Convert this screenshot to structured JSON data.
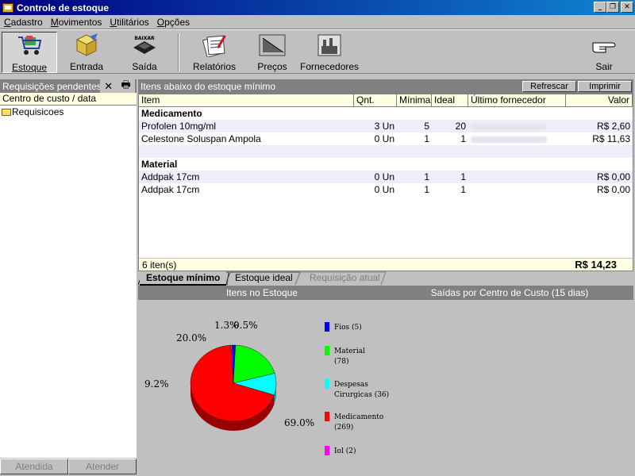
{
  "window": {
    "title": "Controle de estoque"
  },
  "menu": [
    {
      "pre": "",
      "u": "C",
      "post": "adastro"
    },
    {
      "pre": "",
      "u": "M",
      "post": "ovimentos"
    },
    {
      "pre": "",
      "u": "U",
      "post": "tilitários"
    },
    {
      "pre": "",
      "u": "O",
      "post": "pções"
    }
  ],
  "toolbar": {
    "estoque": "Estoque",
    "entrada": "Entrada",
    "saida": "Saída",
    "relatorios": "Relatórios",
    "precos": "Preços",
    "fornecedores": "Fornecedores",
    "sair": "Sair",
    "baixar": "BAIXAR"
  },
  "left_panel": {
    "title": "Requisições pendentes",
    "column": "Centro de custo / data",
    "tree_root": "Requisicoes",
    "btn_atendida": "Atendida",
    "btn_atender": "Atender"
  },
  "grid": {
    "title": "Itens abaixo do estoque mínimo",
    "refresh": "Refrescar",
    "print": "Imprimir",
    "columns": [
      "Item",
      "Qnt.",
      "Mínima",
      "Ideal",
      "Último fornecedor",
      "Valor"
    ],
    "groups": [
      {
        "name": "Medicamento",
        "rows": [
          {
            "item": "Profolen 10mg/ml",
            "qnt": "3 Un",
            "min": "5",
            "ideal": "20",
            "valor": "R$  2,60"
          },
          {
            "item": "Celestone Soluspan Ampola",
            "qnt": "0 Un",
            "min": "1",
            "ideal": "1",
            "valor": "R$  11,63"
          }
        ]
      },
      {
        "name": "Material",
        "rows": [
          {
            "item": "Addpak 17cm",
            "qnt": "0 Un",
            "min": "1",
            "ideal": "1",
            "valor": "R$  0,00"
          },
          {
            "item": "Addpak 17cm",
            "qnt": "0 Un",
            "min": "1",
            "ideal": "1",
            "valor": "R$ 0,00"
          }
        ]
      }
    ],
    "footer_count": "6 iten(s)",
    "footer_total": "R$  14,23"
  },
  "tabs": [
    "Estoque mínimo",
    "Estoque ideal",
    "Requisição atual"
  ],
  "chart_header": [
    "Itens no Estoque",
    "Saídas por Centro de Custo (15 dias)"
  ],
  "chart_data": {
    "type": "pie",
    "slices": [
      {
        "name": "Fios (5)",
        "value": 5,
        "label": "1.3%",
        "color": "#0000ff"
      },
      {
        "name": "Material (78)",
        "value": 78,
        "label": "20.0%",
        "color": "#00ff00"
      },
      {
        "name": "Despesas Cirurgicas (36)",
        "value": 36,
        "label": "9.2%",
        "color": "#00ffff"
      },
      {
        "name": "Medicamento (269)",
        "value": 269,
        "label": "69.0%",
        "color": "#ff0000"
      },
      {
        "name": "Iol (2)",
        "value": 2,
        "label": "0.5%",
        "color": "#ff00ff"
      }
    ],
    "legend_lines": [
      [
        "Fios (5)"
      ],
      [
        "Material",
        "(78)"
      ],
      [
        "Despesas",
        "Cirurgicas (36)"
      ],
      [
        "Medicamento",
        "(269)"
      ],
      [
        "Iol (2)"
      ]
    ]
  }
}
